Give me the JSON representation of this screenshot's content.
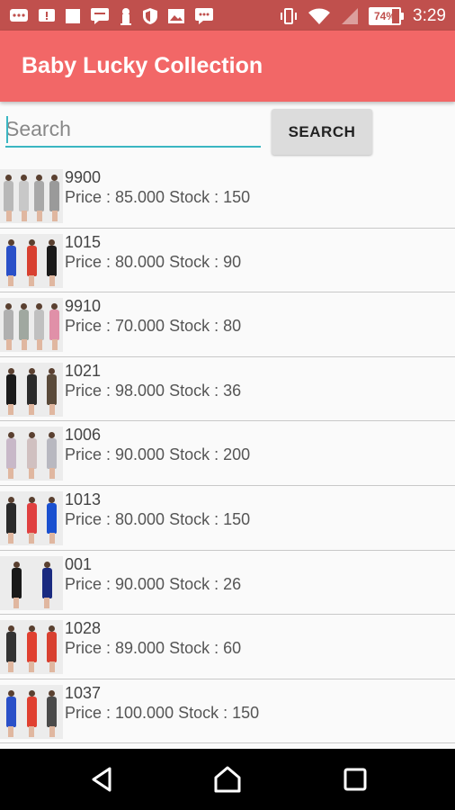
{
  "status_bar": {
    "time": "3:29",
    "battery": "74%",
    "battery_level": 0.74,
    "icons": [
      "message-icon",
      "notification-icon",
      "square-icon",
      "chat-icon",
      "hydrant-icon",
      "shield-icon",
      "image-icon",
      "sms-icon",
      "vibrate-icon",
      "wifi-icon",
      "signal-icon",
      "battery-icon"
    ]
  },
  "app_bar": {
    "title": "Baby Lucky Collection"
  },
  "search": {
    "placeholder": "Search",
    "button_label": "SEARCH"
  },
  "products": [
    {
      "code": "9900",
      "detail": "Price : 85.000 Stock : 150"
    },
    {
      "code": "1015",
      "detail": "Price : 80.000 Stock : 90"
    },
    {
      "code": "9910",
      "detail": "Price : 70.000 Stock : 80"
    },
    {
      "code": "1021",
      "detail": "Price : 98.000 Stock : 36"
    },
    {
      "code": "1006",
      "detail": "Price : 90.000 Stock : 200"
    },
    {
      "code": "1013",
      "detail": "Price : 80.000 Stock : 150"
    },
    {
      "code": "001",
      "detail": "Price : 90.000 Stock : 26"
    },
    {
      "code": "1028",
      "detail": "Price : 89.000 Stock : 60"
    },
    {
      "code": "1037",
      "detail": "Price : 100.000 Stock : 150"
    }
  ],
  "colors": {
    "status_bar": "#c0504d",
    "app_bar": "#f26767",
    "accent": "#3ab6c2",
    "thumb_palettes": [
      [
        "#b8b8b8",
        "#c8c8c8",
        "#a8a8a8",
        "#9a9a9a"
      ],
      [
        "#2a50c8",
        "#d84030",
        "#1a1a1a"
      ],
      [
        "#b0b0b0",
        "#a0a8a0",
        "#c0c0c0",
        "#e090a8"
      ],
      [
        "#1a1a1a",
        "#2a2a2a",
        "#5a4a3a"
      ],
      [
        "#c8b8c8",
        "#d0c0c0",
        "#b8b8c0"
      ],
      [
        "#2a2a2a",
        "#e04040",
        "#1a50d0"
      ],
      [
        "#1a1a1a",
        "#1a2a80"
      ],
      [
        "#333333",
        "#e04030",
        "#d84030"
      ],
      [
        "#2a50c8",
        "#e04030",
        "#4a4a4a"
      ]
    ]
  },
  "nav_bar": {
    "buttons": [
      "back-icon",
      "home-icon",
      "recents-icon"
    ]
  }
}
